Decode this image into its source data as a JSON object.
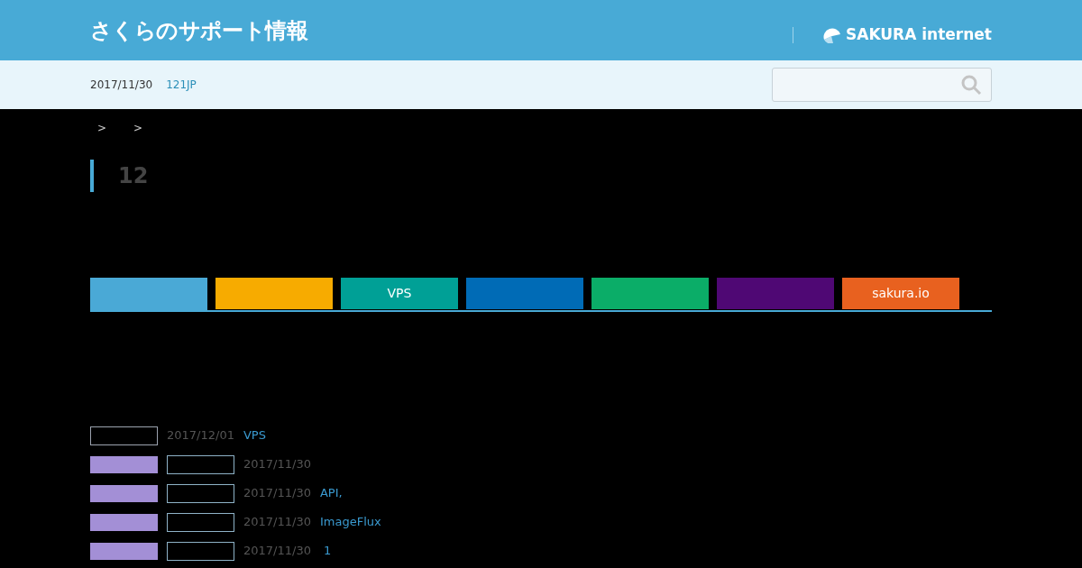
{
  "header": {
    "site_title": "さくらのサポート情報",
    "logo_text": "SAKURA internet"
  },
  "subbar": {
    "date": "2017/11/30",
    "link": "121JP"
  },
  "breadcrumb": [
    ">",
    ">"
  ],
  "heading": "12",
  "tabs": [
    {
      "color": "#4aa9d6",
      "selected": true
    },
    {
      "color": "#f7ab00",
      "selected": false
    },
    {
      "label": "VPS",
      "color": "#00a096",
      "selected": false
    },
    {
      "color": "#006bb6",
      "selected": false
    },
    {
      "color": "#0bad68",
      "selected": false
    },
    {
      "color": "#4f0874",
      "selected": false
    },
    {
      "label": "sakura.io",
      "color": "#e8611f",
      "selected": false
    }
  ],
  "news": [
    {
      "tags": [
        {
          "kind": "outline",
          "color": "#9ca3af"
        }
      ],
      "date": "2017/12/01",
      "title": "VPS"
    },
    {
      "tags": [
        {
          "kind": "filled",
          "color": "#a38fd6"
        },
        {
          "kind": "outline",
          "color": "#8fb3c8"
        }
      ],
      "date": "2017/11/30"
    },
    {
      "tags": [
        {
          "kind": "filled",
          "color": "#a38fd6"
        },
        {
          "kind": "outline",
          "color": "#8fb3c8"
        }
      ],
      "date": "2017/11/30",
      "title": "API,"
    },
    {
      "tags": [
        {
          "kind": "filled",
          "color": "#a38fd6"
        },
        {
          "kind": "outline",
          "color": "#8fb3c8"
        }
      ],
      "date": "2017/11/30",
      "title": "ImageFlux"
    },
    {
      "tags": [
        {
          "kind": "filled",
          "color": "#a38fd6"
        },
        {
          "kind": "outline",
          "color": "#8fb3c8"
        }
      ],
      "date": "2017/11/30",
      "title": " 1"
    }
  ]
}
